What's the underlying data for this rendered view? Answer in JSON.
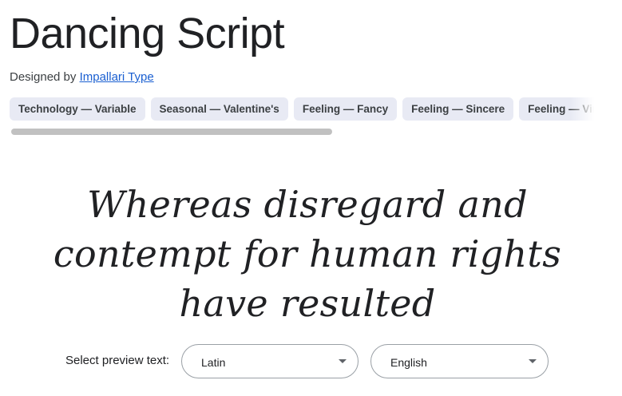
{
  "font": {
    "name": "Dancing Script",
    "designed_by_prefix": "Designed by ",
    "designer_name": "Impallari Type"
  },
  "tags": [
    "Technology — Variable",
    "Seasonal — Valentine's",
    "Feeling — Fancy",
    "Feeling — Sincere",
    "Feeling — Vintage"
  ],
  "preview": {
    "text": "Whereas disregard and contempt for human rights have resulted"
  },
  "preview_controls": {
    "label": "Select preview text:",
    "script_value": "Latin",
    "language_value": "English"
  },
  "colors": {
    "link": "#1a5fd1",
    "chip_bg": "#e8eaf4",
    "text": "#202124"
  }
}
